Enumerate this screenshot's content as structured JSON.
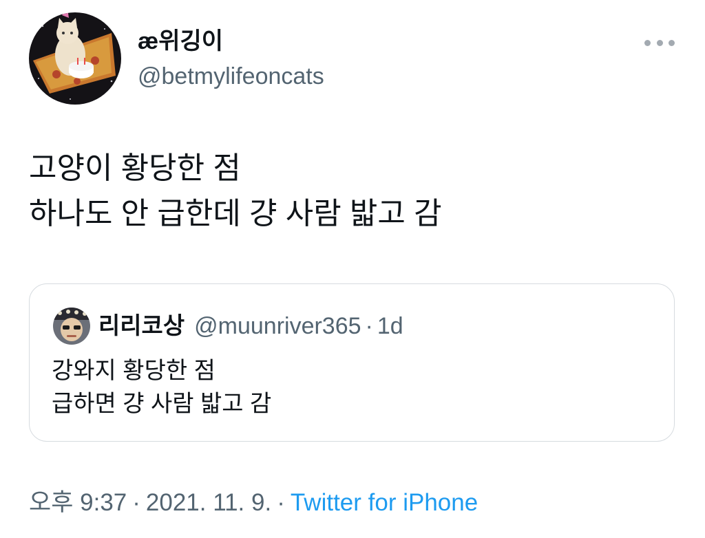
{
  "author": {
    "display_name": "æ위깅이",
    "handle": "@betmylifeoncats",
    "avatar_icon": "cat-birthday-avatar"
  },
  "more_icon": "more-options-icon",
  "tweet": {
    "lines": [
      "고양이 황당한 점",
      "하나도 안 급한데 걍 사람 밟고 감"
    ]
  },
  "quote": {
    "display_name": "리리코상",
    "handle": "@muunriver365",
    "separator": "·",
    "time": "1d",
    "avatar_icon": "person-avatar",
    "lines": [
      "강와지 황당한 점",
      "급하면 걍 사람 밟고 감"
    ]
  },
  "meta": {
    "time": "오후 9:37",
    "separator": "·",
    "date": "2021. 11. 9.",
    "source": "Twitter for iPhone"
  },
  "colors": {
    "text": "#0f1419",
    "secondary": "#536471",
    "link": "#1d9bf0",
    "border": "#d6dbdf"
  }
}
